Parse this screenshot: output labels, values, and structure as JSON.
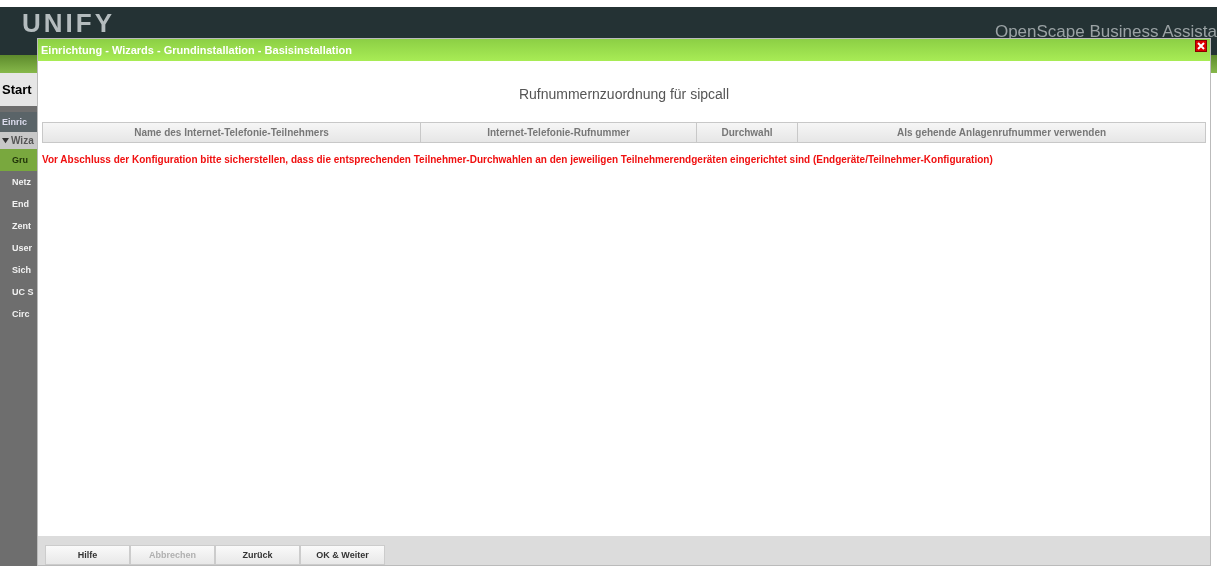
{
  "app": {
    "logo": "UNIFY",
    "product": "OpenScape Business Assista",
    "sidebar": {
      "title": "Start",
      "section": "Einric",
      "items": [
        {
          "label": "Wiza",
          "expanded": true,
          "children": [
            {
              "label": "Gru",
              "selected": true
            },
            {
              "label": "Netz",
              "selected": false
            },
            {
              "label": "End",
              "selected": false
            },
            {
              "label": "Zent",
              "selected": false
            },
            {
              "label": "User",
              "selected": false
            },
            {
              "label": "Sich",
              "selected": false
            },
            {
              "label": "UC S",
              "selected": false
            },
            {
              "label": "Circ",
              "selected": false
            }
          ]
        }
      ]
    }
  },
  "dialog": {
    "title": "Einrichtung - Wizards - Grundinstallation - Basisinstallation",
    "heading": "Rufnummernzuordnung für sipcall",
    "table": {
      "columns": [
        "Name des Internet-Telefonie-Teilnehmers",
        "Internet-Telefonie-Rufnummer",
        "Durchwahl",
        "Als gehende Anlagenrufnummer verwenden"
      ]
    },
    "warning": "Vor Abschluss der Konfiguration bitte sicherstellen, dass die entsprechenden Teilnehmer-Durchwahlen an den jeweiligen Teilnehmerendgeräten eingerichtet sind (Endgeräte/Teilnehmer-Konfiguration)",
    "buttons": [
      {
        "label": "Hilfe",
        "disabled": false
      },
      {
        "label": "Abbrechen",
        "disabled": true
      },
      {
        "label": "Zurück",
        "disabled": false
      },
      {
        "label": "OK & Weiter",
        "disabled": false
      }
    ]
  }
}
